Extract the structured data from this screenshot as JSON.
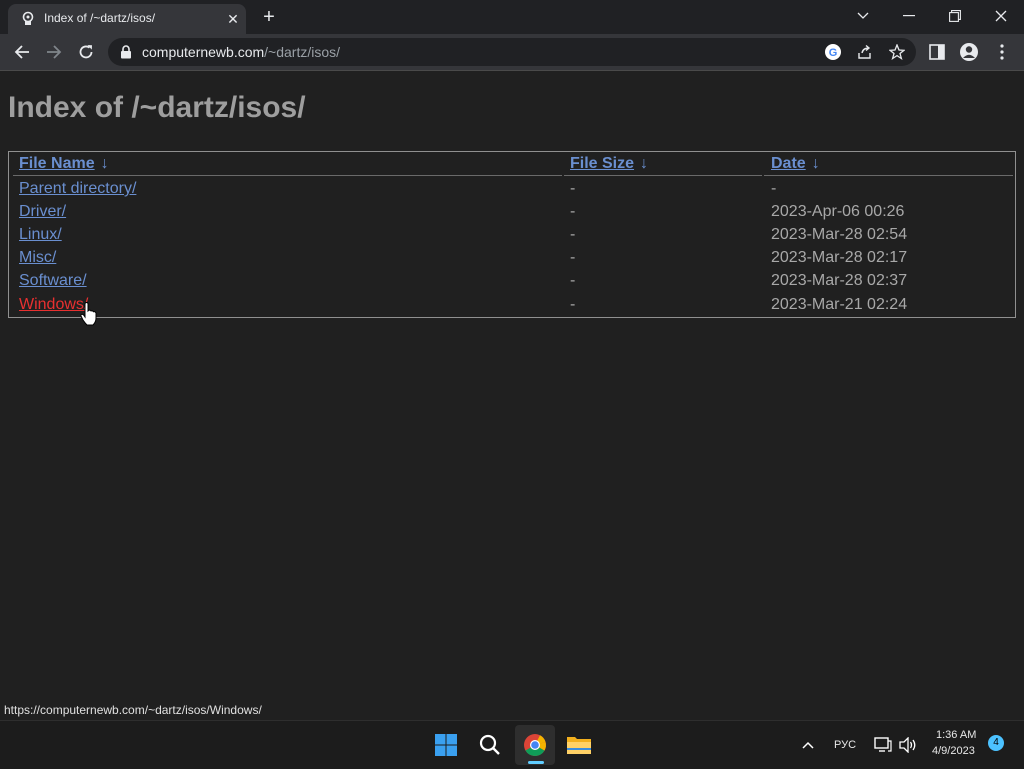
{
  "browser": {
    "tab_title": "Index of /~dartz/isos/",
    "url_host": "computernewb.com",
    "url_path": "/~dartz/isos/"
  },
  "page": {
    "heading": "Index of /~dartz/isos/",
    "columns": {
      "name": "File Name",
      "size": "File Size",
      "date": "Date",
      "sort_arrow": "↓"
    },
    "rows": [
      {
        "name": "Parent directory/",
        "size": "-",
        "date": "-"
      },
      {
        "name": "Driver/",
        "size": "-",
        "date": "2023-Apr-06 00:26"
      },
      {
        "name": "Linux/",
        "size": "-",
        "date": "2023-Mar-28 02:54"
      },
      {
        "name": "Misc/",
        "size": "-",
        "date": "2023-Mar-28 02:17"
      },
      {
        "name": "Software/",
        "size": "-",
        "date": "2023-Mar-28 02:37"
      },
      {
        "name": "Windows/",
        "size": "-",
        "date": "2023-Mar-21 02:24"
      }
    ]
  },
  "status_url": "https://computernewb.com/~dartz/isos/Windows/",
  "taskbar": {
    "language": "РУС",
    "time": "1:36 AM",
    "date": "4/9/2023",
    "notification_count": "4"
  },
  "colors": {
    "link": "#6a8fd0",
    "link_hover": "#e83030",
    "page_bg": "#202020",
    "heading": "#9e9e9e"
  },
  "icons": [
    "favicon-icon",
    "close-icon",
    "plus-icon",
    "chevron-down-icon",
    "minimize-icon",
    "restore-icon",
    "close-window-icon",
    "back-icon",
    "forward-icon",
    "reload-icon",
    "lock-icon",
    "google-icon",
    "share-icon",
    "star-icon",
    "side-panel-icon",
    "profile-icon",
    "menu-icon",
    "hand-cursor-icon",
    "windows-start-icon",
    "search-icon",
    "chrome-icon",
    "file-explorer-icon",
    "chevron-up-icon",
    "network-icon",
    "volume-icon"
  ]
}
